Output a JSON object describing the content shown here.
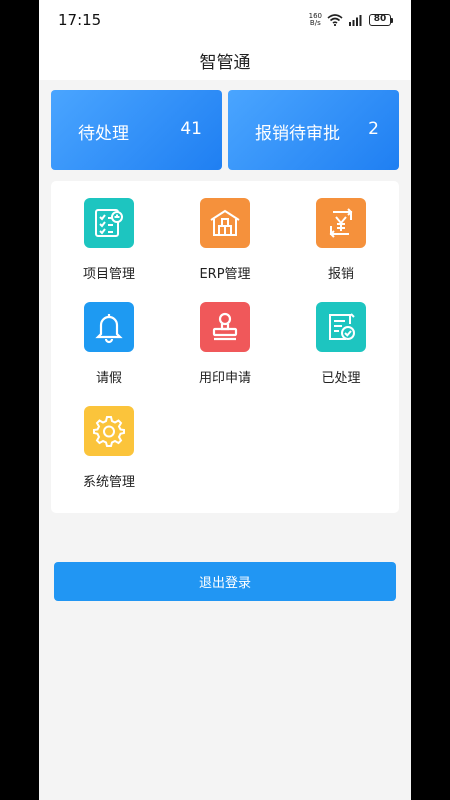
{
  "status_bar": {
    "time": "17:15",
    "net_speed_value": "160",
    "net_speed_unit": "B/s",
    "battery": "80"
  },
  "header": {
    "title": "智管通"
  },
  "summary": [
    {
      "label": "待处理",
      "count": "41"
    },
    {
      "label": "报销待审批",
      "count": "2"
    }
  ],
  "menu": [
    {
      "label": "项目管理",
      "icon": "project-checklist-icon",
      "color": "#1dc5c0"
    },
    {
      "label": "ERP管理",
      "icon": "warehouse-icon",
      "color": "#f5913c"
    },
    {
      "label": "报销",
      "icon": "reimburse-yuan-icon",
      "color": "#f5913c"
    },
    {
      "label": "请假",
      "icon": "bell-icon",
      "color": "#1e9af2"
    },
    {
      "label": "用印申请",
      "icon": "stamp-icon",
      "color": "#f0585a"
    },
    {
      "label": "已处理",
      "icon": "processed-doc-icon",
      "color": "#1dc5c0"
    },
    {
      "label": "系统管理",
      "icon": "gear-icon",
      "color": "#fbc43b"
    }
  ],
  "logout_label": "退出登录",
  "colors": {
    "primary": "#2196f3",
    "card_gradient_start": "#4aa5ff",
    "card_gradient_end": "#1f7ff2"
  }
}
